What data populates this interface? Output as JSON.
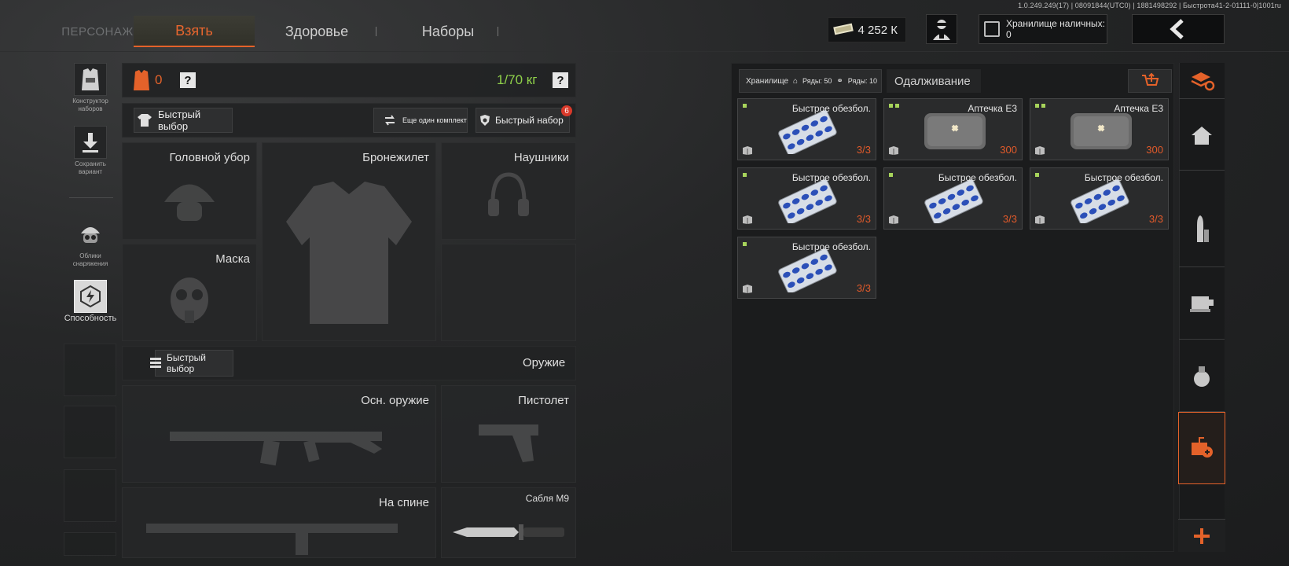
{
  "version": "1.0.249.249(17) | 08091844(UTC0) | 1881498292 | Быстрота41-2-01111-0|1001ru",
  "nav": {
    "character": "ПЕРСОНАЖ",
    "tabs": [
      "Взять",
      "Здоровье",
      "Наборы"
    ]
  },
  "header": {
    "money": "4 252 К",
    "cash_storage": "Хранилище наличных: 0"
  },
  "left_sidebar": {
    "kit_builder": "Конструктор наборов",
    "save_variant": "Сохранить вариант",
    "gear_skins": "Облики снаряжения",
    "ability": "Способность"
  },
  "loadout": {
    "armor_count": "0",
    "weight": "1/70 кг",
    "quick_select": "Быстрый выбор",
    "another_set": "Еще один комплект",
    "quick_kit": "Быстрый набор",
    "quick_kit_badge": "6",
    "slots": {
      "headwear": "Головной убор",
      "vest": "Бронежилет",
      "headphones": "Наушники",
      "mask": "Маска"
    },
    "weapons": {
      "quick_select": "Быстрый выбор",
      "title": "Оружие",
      "primary": "Осн. оружие",
      "pistol": "Пистолет",
      "back": "На спине",
      "melee": "Сабля М9"
    }
  },
  "storage": {
    "tab_label": "Хранилище",
    "rows_home": "Ряды: 50",
    "rows_other": "Ряды: 10",
    "lending": "Одалживание",
    "items": [
      {
        "name": "Быстрое обезбол.",
        "qty": "3/3",
        "type": "pills",
        "marks": 1
      },
      {
        "name": "Аптечка Е3",
        "qty": "300",
        "type": "medkit",
        "marks": 2
      },
      {
        "name": "Аптечка Е3",
        "qty": "300",
        "type": "medkit",
        "marks": 2
      },
      {
        "name": "Быстрое обезбол.",
        "qty": "3/3",
        "type": "pills",
        "marks": 1
      },
      {
        "name": "Быстрое обезбол.",
        "qty": "3/3",
        "type": "pills",
        "marks": 1
      },
      {
        "name": "Быстрое обезбол.",
        "qty": "3/3",
        "type": "pills",
        "marks": 1
      },
      {
        "name": "Быстрое обезбол.",
        "qty": "3/3",
        "type": "pills",
        "marks": 1
      }
    ]
  },
  "colors": {
    "accent": "#e4622a",
    "weight": "#8fd14a",
    "badge": "#d9392a"
  }
}
